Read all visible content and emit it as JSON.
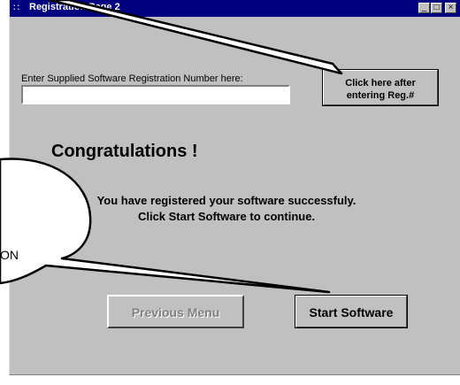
{
  "window": {
    "title": "Registration Page 2",
    "system_icon": "∷",
    "controls": {
      "minimize": "_",
      "maximize": "□",
      "close": "×"
    }
  },
  "registration": {
    "label": "Enter Supplied Software Registration Number here:",
    "input_value": "",
    "input_placeholder": "",
    "submit_line1": "Click here after",
    "submit_line2": "entering Reg.#"
  },
  "main": {
    "heading": "Congratulations !",
    "message_line1": "You have registered your software successfuly.",
    "message_line2": "Click  Start Software to continue."
  },
  "buttons": {
    "previous": "Previous Menu",
    "start": "Start Software"
  },
  "annotation": {
    "bubble_text": "ON"
  },
  "colors": {
    "titlebar": "#000080",
    "window_face": "#c0c0c0",
    "disabled_text": "#808080"
  }
}
